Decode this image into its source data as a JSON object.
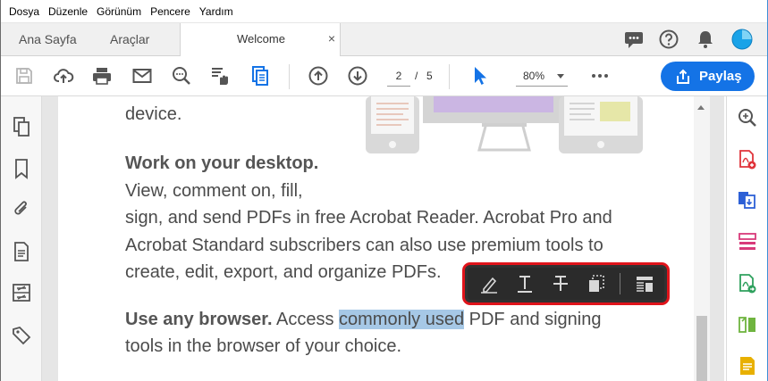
{
  "menubar": {
    "items": [
      "Dosya",
      "Düzenle",
      "Görünüm",
      "Pencere",
      "Yardım"
    ]
  },
  "tabs": {
    "home_label": "Ana Sayfa",
    "tools_label": "Araçlar",
    "doc_label": "Welcome",
    "doc_close": "×"
  },
  "toolbar": {
    "page_current": "2",
    "page_separator": "/",
    "page_total": "5",
    "zoom": "80%",
    "share_label": "Paylaş"
  },
  "document": {
    "line_device": "device.",
    "desktop_heading": "Work on your desktop.",
    "desktop_line1": "View, comment on, fill,",
    "desktop_line2": "sign, and send PDFs in free Acrobat Reader. Acrobat Pro and",
    "desktop_line3": "Acrobat Standard subscribers can also use premium tools to",
    "desktop_line4": "create, edit, export, and organize PDFs.",
    "browser_heading": "Use any browser.",
    "browser_pre": " Access ",
    "browser_highlight": "commonly used",
    "browser_post": " PDF and signing",
    "browser_line2": "tools in the browser of your choice."
  },
  "colors": {
    "accent": "#1473e6",
    "highlight": "#a6c8e6",
    "float_toolbar_border": "#e0141b",
    "right_icon_red": "#e0343b",
    "right_icon_blue": "#2d60d6",
    "right_icon_pink": "#d83a7a",
    "right_icon_green": "#2ea05d",
    "right_icon_lime": "#6fb43f",
    "right_icon_yellow": "#e8b000"
  },
  "icons": {
    "toolbar": [
      "save-icon",
      "upload-cloud-icon",
      "print-icon",
      "email-icon",
      "search-zoom-icon",
      "redact-hand-icon",
      "document-icon",
      "arrow-up-circle-icon",
      "arrow-down-circle-icon",
      "cursor-select-icon",
      "more-icon"
    ],
    "left_panel": [
      "pages-icon",
      "bookmark-icon",
      "attachment-icon",
      "document-properties-icon",
      "layers-icon",
      "tag-icon"
    ],
    "right_panel": [
      "zoom-tool-icon",
      "create-pdf-icon",
      "combine-files-icon",
      "organize-pages-icon",
      "export-pdf-icon",
      "edit-pdf-icon",
      "comment-icon"
    ],
    "float_toolbar": [
      "highlight-icon",
      "underline-icon",
      "strikethrough-icon",
      "copy-icon",
      "more-options-icon"
    ]
  }
}
